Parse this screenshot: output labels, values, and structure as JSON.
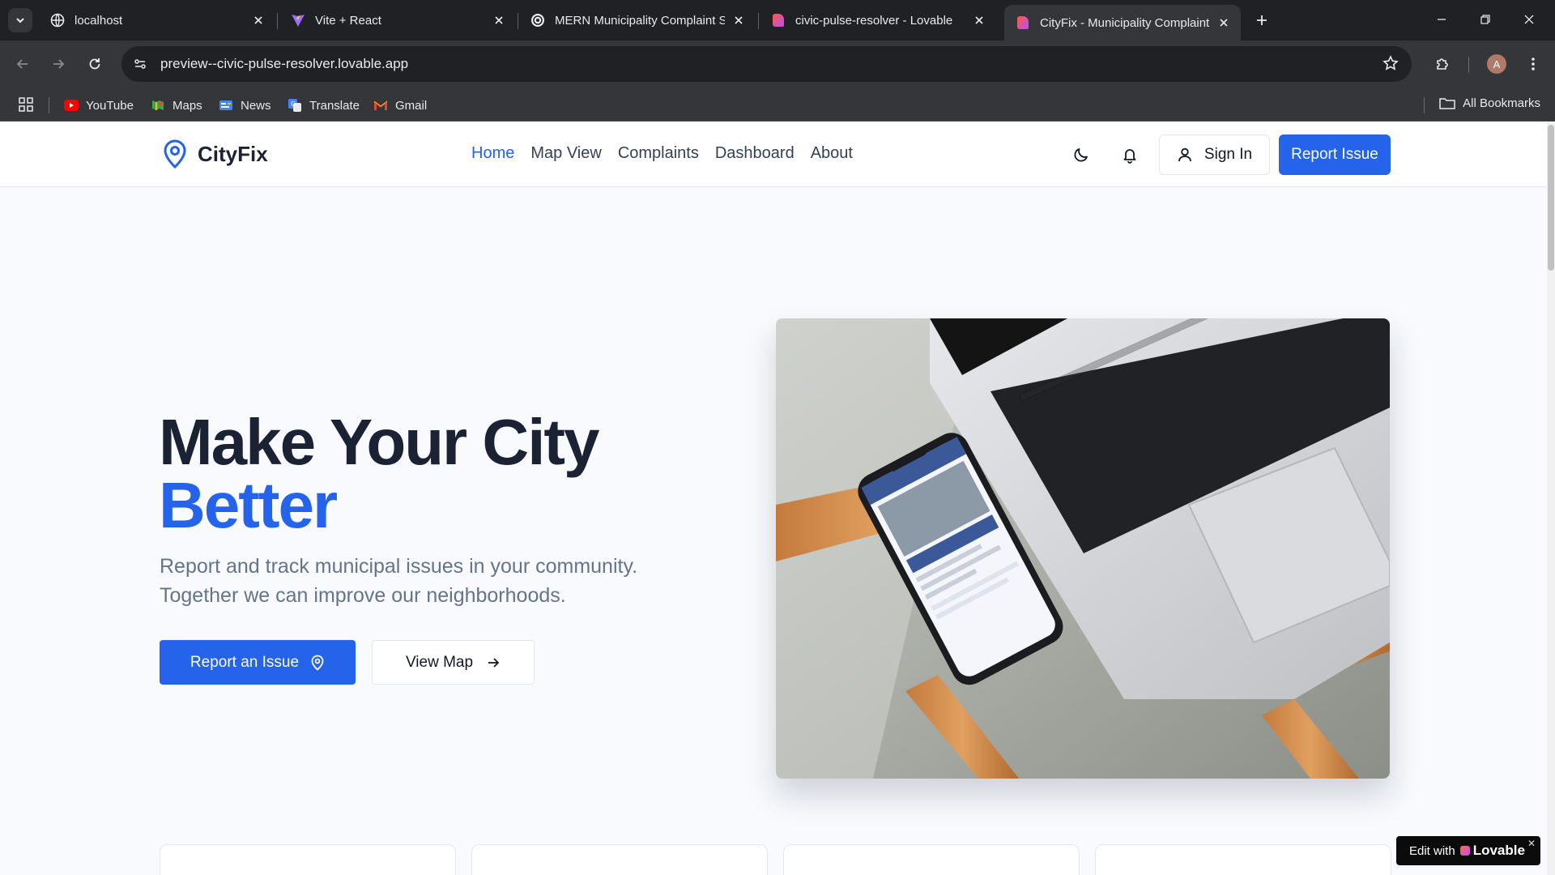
{
  "browser": {
    "tabs": [
      {
        "title": "localhost",
        "favicon": "globe-icon",
        "active": false
      },
      {
        "title": "Vite + React",
        "favicon": "vite-icon",
        "active": false
      },
      {
        "title": "MERN Municipality Complaint S",
        "favicon": "openai-icon",
        "active": false
      },
      {
        "title": "civic-pulse-resolver - Lovable",
        "favicon": "lovable-icon",
        "active": false
      },
      {
        "title": "CityFix - Municipality Complaint",
        "favicon": "lovable-icon",
        "active": true
      }
    ],
    "url": "preview--civic-pulse-resolver.lovable.app",
    "profile_initial": "A",
    "bookmarks": [
      {
        "label": "YouTube",
        "icon": "youtube-icon"
      },
      {
        "label": "Maps",
        "icon": "maps-icon"
      },
      {
        "label": "News",
        "icon": "news-icon"
      },
      {
        "label": "Translate",
        "icon": "translate-icon"
      },
      {
        "label": "Gmail",
        "icon": "gmail-icon"
      }
    ],
    "all_bookmarks_label": "All Bookmarks"
  },
  "header": {
    "logo_text": "CityFix",
    "nav": [
      {
        "label": "Home",
        "active": true
      },
      {
        "label": "Map View",
        "active": false
      },
      {
        "label": "Complaints",
        "active": false
      },
      {
        "label": "Dashboard",
        "active": false
      },
      {
        "label": "About",
        "active": false
      }
    ],
    "sign_in_label": "Sign In",
    "report_issue_label": "Report Issue"
  },
  "hero": {
    "title_line1": "Make Your City",
    "title_line2": "Better",
    "subtitle": "Report and track municipal issues in your community. Together we can improve our neighborhoods.",
    "primary_cta": "Report an Issue",
    "secondary_cta": "View Map"
  },
  "badge": {
    "prefix": "Edit with",
    "brand": "Lovable"
  },
  "colors": {
    "accent": "#2563eb",
    "heading": "#1a2233",
    "muted": "#64748b",
    "page_bg": "#f8fafd"
  }
}
